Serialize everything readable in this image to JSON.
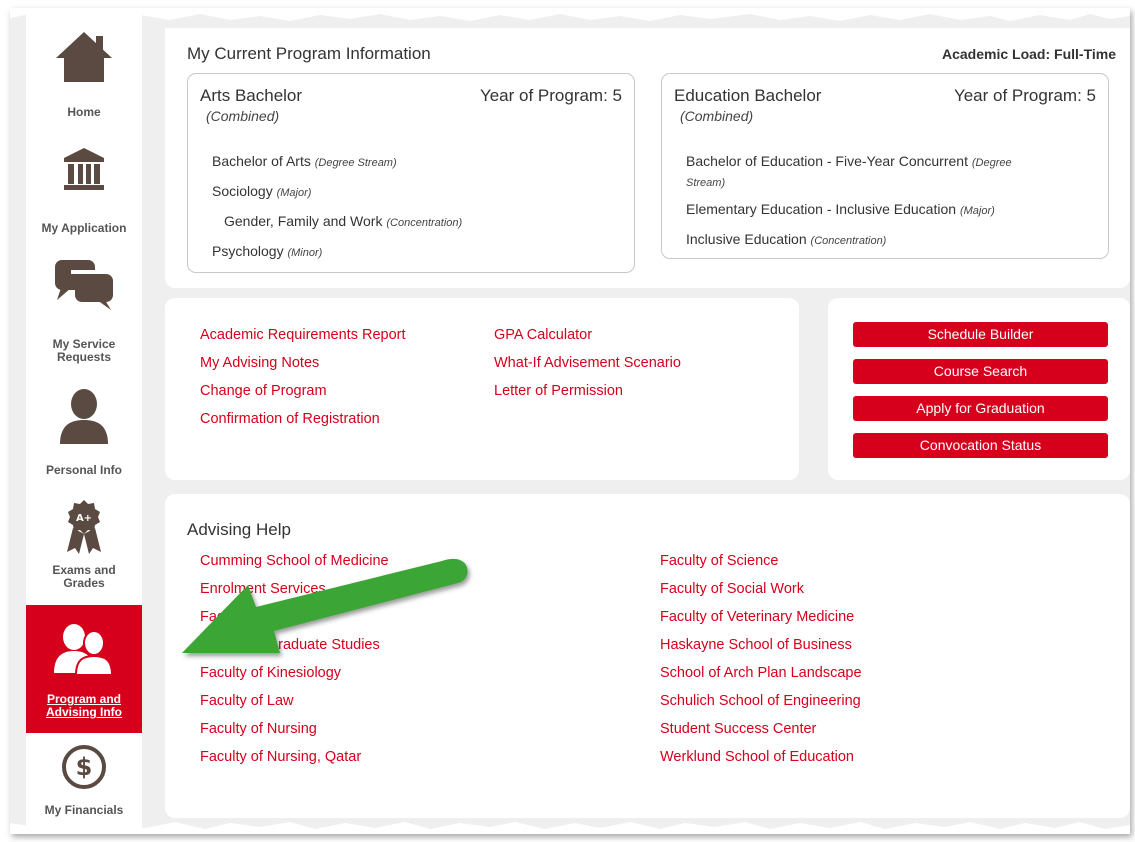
{
  "sidebar": {
    "items": [
      {
        "label": "Home",
        "icon": "home-icon"
      },
      {
        "label": "My Application",
        "icon": "institution-icon"
      },
      {
        "label": "My Service Requests",
        "icon": "chat-bubbles-icon"
      },
      {
        "label": "Personal Info",
        "icon": "person-icon"
      },
      {
        "label": "Exams and Grades",
        "icon": "award-ribbon-icon",
        "badge": "A+"
      },
      {
        "label": "Program and Advising Info",
        "icon": "two-users-icon",
        "active": true
      },
      {
        "label": "My Financials",
        "icon": "dollar-circle-icon"
      }
    ]
  },
  "program_info": {
    "title": "My Current Program Information",
    "academic_load": "Academic Load: Full-Time",
    "programs": [
      {
        "name": "Arts Bachelor",
        "type": "(Combined)",
        "year": "Year of Program: 5",
        "lines": [
          {
            "text": "Bachelor of Arts",
            "tag": "(Degree Stream)"
          },
          {
            "text": "Sociology",
            "tag": "(Major)"
          },
          {
            "text": "Gender, Family and Work",
            "tag": "(Concentration)"
          },
          {
            "text": "Psychology",
            "tag": "(Minor)"
          }
        ]
      },
      {
        "name": "Education Bachelor",
        "type": "(Combined)",
        "year": "Year of Program: 5",
        "lines": [
          {
            "text": "Bachelor of Education - Five-Year Concurrent",
            "tag": "(Degree Stream)",
            "tag_a": "(Degree",
            "tag_b": "Stream)"
          },
          {
            "text": "Elementary Education - Inclusive Education",
            "tag": "(Major)"
          },
          {
            "text": "Inclusive Education",
            "tag": "(Concentration)"
          }
        ]
      }
    ]
  },
  "advising_links": [
    "Academic Requirements Report",
    "My Advising Notes",
    "Change of Program",
    "Confirmation of Registration",
    "GPA Calculator",
    "What-If Advisement Scenario",
    "Letter of Permission"
  ],
  "action_buttons": [
    "Schedule Builder",
    "Course Search",
    "Apply for Graduation",
    "Convocation Status"
  ],
  "advising_help": {
    "title": "Advising Help",
    "left": [
      "Cumming School of Medicine",
      "Enrolment Services",
      "Faculty of Arts",
      "Faculty of Graduate Studies",
      "Faculty of Kinesiology",
      "Faculty of Law",
      "Faculty of Nursing",
      "Faculty of Nursing, Qatar"
    ],
    "right": [
      "Faculty of Science",
      "Faculty of Social Work",
      "Faculty of Veterinary Medicine",
      "Haskayne School of Business",
      "School of Arch Plan Landscape",
      "Schulich School of Engineering",
      "Student Success Center",
      "Werklund School of Education"
    ]
  },
  "colors": {
    "accent": "#d6001c",
    "icon": "#5a4a42",
    "annotation_arrow": "#3aa535"
  }
}
